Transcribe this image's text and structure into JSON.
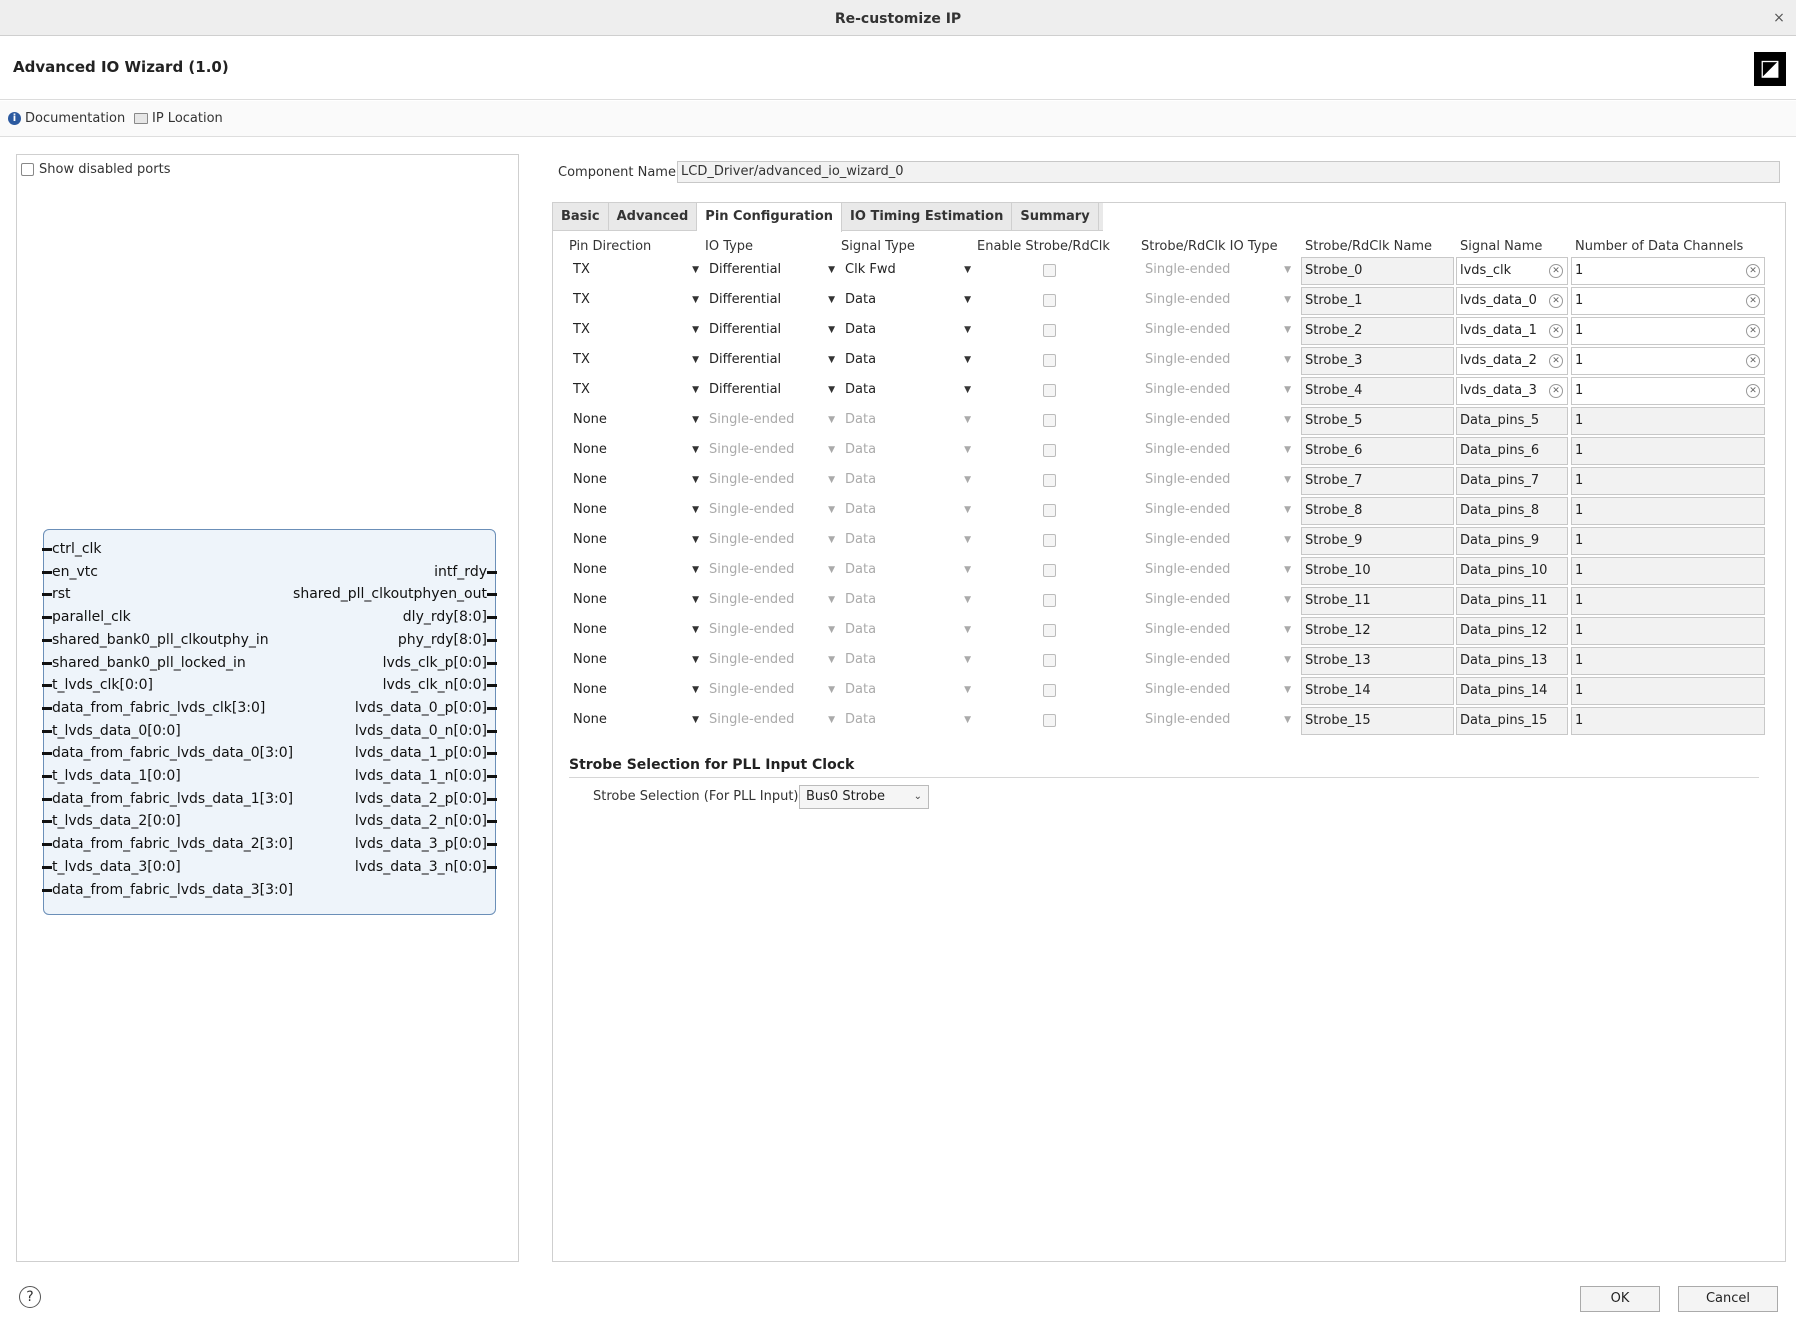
{
  "window": {
    "title": "Re-customize IP",
    "close": "×"
  },
  "header": {
    "title": "Advanced IO Wizard (1.0)"
  },
  "docbar": {
    "documentation": "Documentation",
    "ip_location": "IP Location"
  },
  "left": {
    "show_disabled_ports": "Show disabled ports",
    "inputs": [
      "ctrl_clk",
      "en_vtc",
      "rst",
      "parallel_clk",
      "shared_bank0_pll_clkoutphy_in",
      "shared_bank0_pll_locked_in",
      "t_lvds_clk[0:0]",
      "data_from_fabric_lvds_clk[3:0]",
      "t_lvds_data_0[0:0]",
      "data_from_fabric_lvds_data_0[3:0]",
      "t_lvds_data_1[0:0]",
      "data_from_fabric_lvds_data_1[3:0]",
      "t_lvds_data_2[0:0]",
      "data_from_fabric_lvds_data_2[3:0]",
      "t_lvds_data_3[0:0]",
      "data_from_fabric_lvds_data_3[3:0]"
    ],
    "outputs": [
      "intf_rdy",
      "shared_pll_clkoutphyen_out",
      "dly_rdy[8:0]",
      "phy_rdy[8:0]",
      "lvds_clk_p[0:0]",
      "lvds_clk_n[0:0]",
      "lvds_data_0_p[0:0]",
      "lvds_data_0_n[0:0]",
      "lvds_data_1_p[0:0]",
      "lvds_data_1_n[0:0]",
      "lvds_data_2_p[0:0]",
      "lvds_data_2_n[0:0]",
      "lvds_data_3_p[0:0]",
      "lvds_data_3_n[0:0]"
    ]
  },
  "component": {
    "label": "Component Name",
    "value": "LCD_Driver/advanced_io_wizard_0"
  },
  "tabs": [
    "Basic",
    "Advanced",
    "Pin Configuration",
    "IO Timing Estimation",
    "Summary"
  ],
  "columns": [
    "Pin Direction",
    "IO Type",
    "Signal Type",
    "Enable Strobe/RdClk",
    "Strobe/RdClk IO Type",
    "Strobe/RdClk Name",
    "Signal Name",
    "Number of Data Channels"
  ],
  "rows": [
    {
      "dir": "TX",
      "io": "Differential",
      "sig": "Clk Fwd",
      "strobe_io": "Single-ended",
      "strobe": "Strobe_0",
      "name": "lvds_clk",
      "channels": "1",
      "active": true
    },
    {
      "dir": "TX",
      "io": "Differential",
      "sig": "Data",
      "strobe_io": "Single-ended",
      "strobe": "Strobe_1",
      "name": "lvds_data_0",
      "channels": "1",
      "active": true
    },
    {
      "dir": "TX",
      "io": "Differential",
      "sig": "Data",
      "strobe_io": "Single-ended",
      "strobe": "Strobe_2",
      "name": "lvds_data_1",
      "channels": "1",
      "active": true
    },
    {
      "dir": "TX",
      "io": "Differential",
      "sig": "Data",
      "strobe_io": "Single-ended",
      "strobe": "Strobe_3",
      "name": "lvds_data_2",
      "channels": "1",
      "active": true
    },
    {
      "dir": "TX",
      "io": "Differential",
      "sig": "Data",
      "strobe_io": "Single-ended",
      "strobe": "Strobe_4",
      "name": "lvds_data_3",
      "channels": "1",
      "active": true
    },
    {
      "dir": "None",
      "io": "Single-ended",
      "sig": "Data",
      "strobe_io": "Single-ended",
      "strobe": "Strobe_5",
      "name": "Data_pins_5",
      "channels": "1",
      "active": false
    },
    {
      "dir": "None",
      "io": "Single-ended",
      "sig": "Data",
      "strobe_io": "Single-ended",
      "strobe": "Strobe_6",
      "name": "Data_pins_6",
      "channels": "1",
      "active": false
    },
    {
      "dir": "None",
      "io": "Single-ended",
      "sig": "Data",
      "strobe_io": "Single-ended",
      "strobe": "Strobe_7",
      "name": "Data_pins_7",
      "channels": "1",
      "active": false
    },
    {
      "dir": "None",
      "io": "Single-ended",
      "sig": "Data",
      "strobe_io": "Single-ended",
      "strobe": "Strobe_8",
      "name": "Data_pins_8",
      "channels": "1",
      "active": false
    },
    {
      "dir": "None",
      "io": "Single-ended",
      "sig": "Data",
      "strobe_io": "Single-ended",
      "strobe": "Strobe_9",
      "name": "Data_pins_9",
      "channels": "1",
      "active": false
    },
    {
      "dir": "None",
      "io": "Single-ended",
      "sig": "Data",
      "strobe_io": "Single-ended",
      "strobe": "Strobe_10",
      "name": "Data_pins_10",
      "channels": "1",
      "active": false
    },
    {
      "dir": "None",
      "io": "Single-ended",
      "sig": "Data",
      "strobe_io": "Single-ended",
      "strobe": "Strobe_11",
      "name": "Data_pins_11",
      "channels": "1",
      "active": false
    },
    {
      "dir": "None",
      "io": "Single-ended",
      "sig": "Data",
      "strobe_io": "Single-ended",
      "strobe": "Strobe_12",
      "name": "Data_pins_12",
      "channels": "1",
      "active": false
    },
    {
      "dir": "None",
      "io": "Single-ended",
      "sig": "Data",
      "strobe_io": "Single-ended",
      "strobe": "Strobe_13",
      "name": "Data_pins_13",
      "channels": "1",
      "active": false
    },
    {
      "dir": "None",
      "io": "Single-ended",
      "sig": "Data",
      "strobe_io": "Single-ended",
      "strobe": "Strobe_14",
      "name": "Data_pins_14",
      "channels": "1",
      "active": false
    },
    {
      "dir": "None",
      "io": "Single-ended",
      "sig": "Data",
      "strobe_io": "Single-ended",
      "strobe": "Strobe_15",
      "name": "Data_pins_15",
      "channels": "1",
      "active": false
    }
  ],
  "strobe_section": {
    "title": "Strobe Selection for PLL Input Clock",
    "label": "Strobe Selection (For PLL Input)",
    "value": "Bus0 Strobe"
  },
  "footer": {
    "help": "?",
    "ok": "OK",
    "cancel": "Cancel"
  },
  "colors": {
    "accent": "#2c5aa0",
    "symbol_fill": "#eef4fa",
    "symbol_border": "#6b8fb8"
  }
}
